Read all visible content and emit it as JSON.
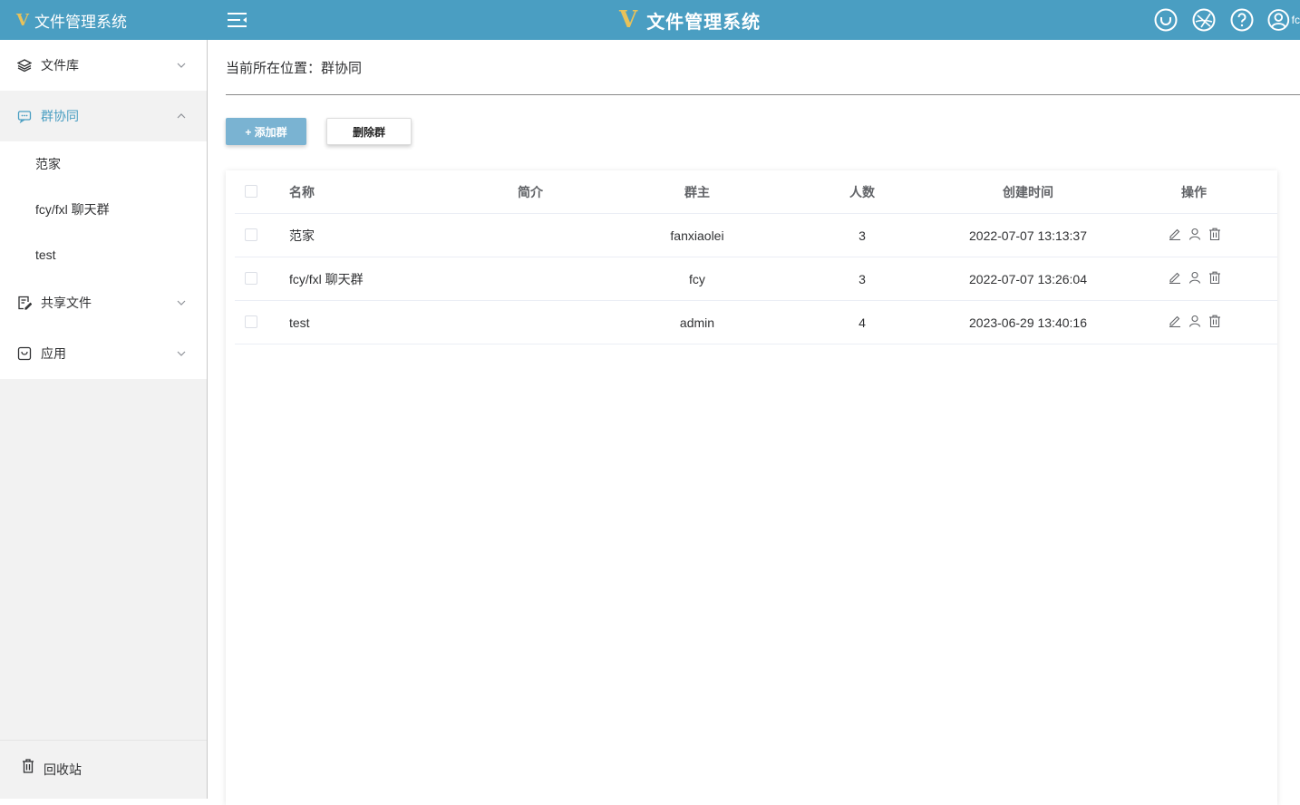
{
  "header": {
    "brand_logo": "V",
    "brand_title": "文件管理系统",
    "center_logo": "V",
    "center_title": "文件管理系统",
    "user_initial": "fc",
    "bg_color": "#4a9ec2"
  },
  "sidebar": {
    "items": [
      {
        "label": "文件库",
        "icon": "layers-icon"
      },
      {
        "label": "群协同",
        "icon": "chat-icon"
      },
      {
        "label": "共享文件",
        "icon": "share-doc-icon"
      },
      {
        "label": "应用",
        "icon": "app-icon"
      }
    ],
    "sub_items": [
      "范家",
      "fcy/fxl 聊天群",
      "test"
    ],
    "recycle_label": "回收站"
  },
  "breadcrumb": {
    "label": "当前所在位置：",
    "value": "群协同"
  },
  "toolbar": {
    "add_label": "+ 添加群",
    "delete_label": "删除群"
  },
  "table": {
    "headers": {
      "name": "名称",
      "desc": "简介",
      "owner": "群主",
      "count": "人数",
      "created": "创建时间",
      "ops": "操作"
    },
    "rows": [
      {
        "name": "范家",
        "desc": "",
        "owner": "fanxiaolei",
        "count": "3",
        "created": "2022-07-07 13:13:37"
      },
      {
        "name": "fcy/fxl 聊天群",
        "desc": "",
        "owner": "fcy",
        "count": "3",
        "created": "2022-07-07 13:26:04"
      },
      {
        "name": "test",
        "desc": "",
        "owner": "admin",
        "count": "4",
        "created": "2023-06-29 13:40:16"
      }
    ]
  }
}
